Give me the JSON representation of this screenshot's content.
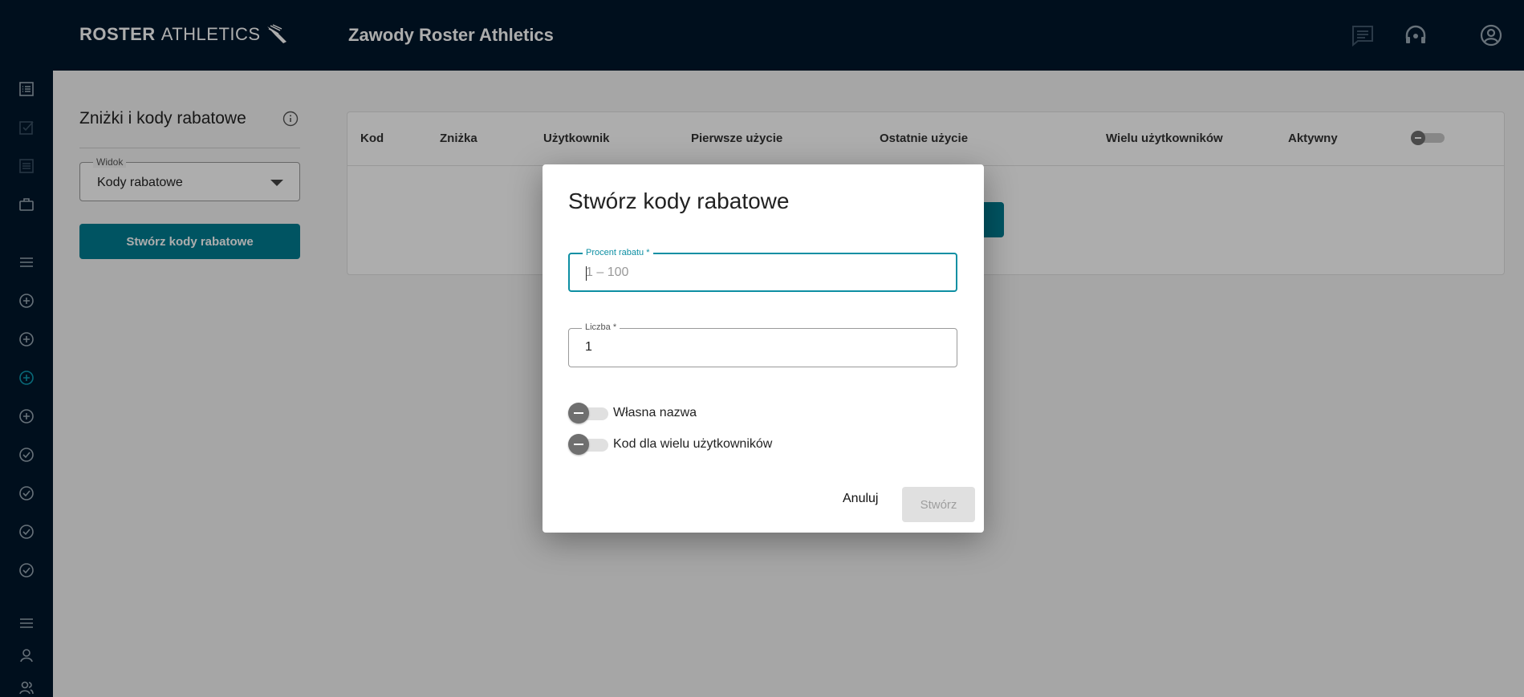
{
  "header": {
    "logo_bold": "ROSTER",
    "logo_light": "ATHLETICS",
    "title": "Zawody Roster Athletics",
    "icons": [
      "chat-icon",
      "headset-icon",
      "account-circle-icon"
    ]
  },
  "sidebar": {
    "icons": [
      "list-icon",
      "checkbox-icon",
      "list-alt-icon",
      "briefcase-icon",
      "menu-icon",
      "add-circle-icon",
      "add-circle-icon",
      "add-circle-icon",
      "add-circle-icon",
      "check-circle-icon",
      "check-circle-icon",
      "check-circle-icon",
      "check-circle-icon",
      "menu-icon",
      "person-icon",
      "people-icon"
    ],
    "active_index": 7
  },
  "panel": {
    "title": "Zniżki i kody rabatowe",
    "view_label": "Widok",
    "view_value": "Kody rabatowe",
    "create_button": "Stwórz kody rabatowe"
  },
  "table": {
    "columns": [
      "Kod",
      "Zniżka",
      "Użytkownik",
      "Pierwsze użycie",
      "Ostatnie użycie",
      "Wielu użytkowników",
      "Aktywny"
    ]
  },
  "dialog": {
    "title": "Stwórz kody rabatowe",
    "percent_label": "Procent rabatu *",
    "percent_placeholder": "1 – 100",
    "count_label": "Liczba *",
    "count_value": "1",
    "toggle_custom_name": "Własna nazwa",
    "toggle_multi_user": "Kod dla wielu użytkowników",
    "cancel": "Anuluj",
    "create": "Stwórz"
  },
  "colors": {
    "navy": "#00172b",
    "teal": "#007c91",
    "focus": "#0d8fa3"
  }
}
